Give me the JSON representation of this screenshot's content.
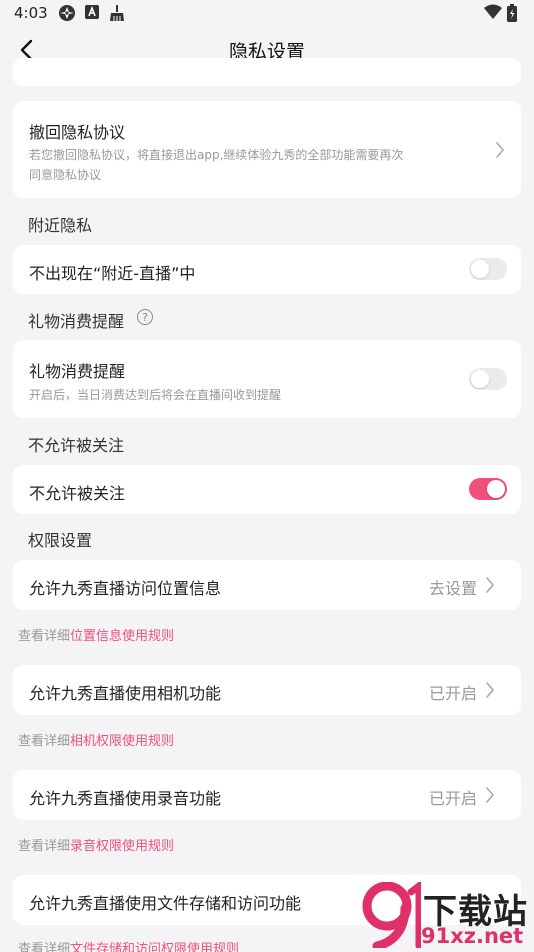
{
  "status_bar": {
    "time": "4:03",
    "left_icons": [
      "fan-icon",
      "font-icon",
      "broom-icon"
    ],
    "right_icons": [
      "wifi-icon",
      "battery-icon"
    ]
  },
  "nav": {
    "title": "隐私设置",
    "back_icon": "chevron-left-icon"
  },
  "revoke": {
    "title": "撤回隐私协议",
    "desc_line1": "若您撤回隐私协议，将直接退出app,继续体验九秀的全部功能需要再次",
    "desc_line2": "同意隐私协议"
  },
  "nearby": {
    "section": "附近隐私",
    "title": "不出现在“附近-直播”中",
    "enabled": false
  },
  "gift": {
    "section": "礼物消费提醒",
    "help_glyph": "?",
    "title": "礼物消费提醒",
    "desc": "开启后，当日消费达到后将会在直播间收到提醒",
    "enabled": false
  },
  "follow": {
    "section": "不允许被关注",
    "title": "不允许被关注",
    "enabled": true
  },
  "permissions": {
    "section": "权限设置",
    "items": [
      {
        "title": "允许九秀直播访问位置信息",
        "value": "去设置",
        "rule_prefix": "查看详细",
        "rule_link": "位置信息使用规则"
      },
      {
        "title": "允许九秀直播使用相机功能",
        "value": "已开启",
        "rule_prefix": "查看详细",
        "rule_link": "相机权限使用规则"
      },
      {
        "title": "允许九秀直播使用录音功能",
        "value": "已开启",
        "rule_prefix": "查看详细",
        "rule_link": "录音权限使用规则"
      },
      {
        "title": "允许九秀直播使用文件存储和访问功能",
        "value": "",
        "rule_prefix": "查看详细",
        "rule_link": "文件存储和访问权限使用规则"
      }
    ]
  },
  "watermark": {
    "text": "下载站",
    "url": "91xz.net"
  },
  "colors": {
    "accent": "#f0507a",
    "background": "#f4f4f6",
    "card": "#ffffff",
    "secondary_text": "#999999"
  }
}
